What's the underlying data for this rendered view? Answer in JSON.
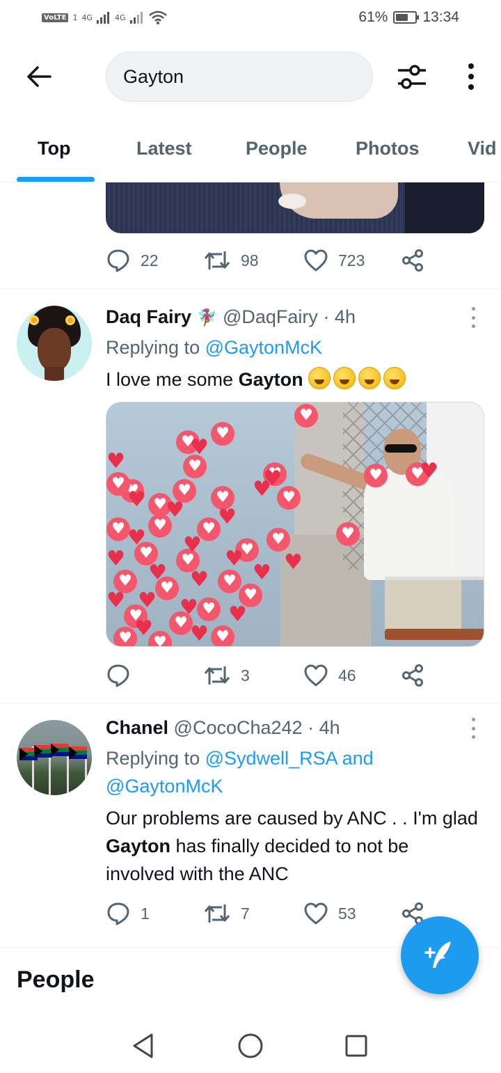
{
  "status_bar": {
    "network_left": "VoLTE",
    "sim_slot": "1",
    "signal1": "4G",
    "signal2": "4G",
    "battery": "61%",
    "time": "13:34"
  },
  "header": {
    "search_value": "Gayton"
  },
  "tabs": [
    {
      "label": "Top",
      "active": true
    },
    {
      "label": "Latest",
      "active": false
    },
    {
      "label": "People",
      "active": false
    },
    {
      "label": "Photos",
      "active": false
    },
    {
      "label": "Vid",
      "active": false
    }
  ],
  "prev_tweet": {
    "replies": "22",
    "retweets": "98",
    "likes": "723"
  },
  "tweets": [
    {
      "name": "Daq Fairy",
      "name_emoji": "🧚🏾‍♀️",
      "handle": "@DaqFairy",
      "time": "· 4h",
      "replying_prefix": "Replying to",
      "replying_to": "@GaytonMcK",
      "text_before": "I love me some ",
      "text_bold": "Gayton",
      "emoji_count": "4",
      "emoji_name": "rolling-on-floor-laughing",
      "replies": "",
      "retweets": "3",
      "likes": "46"
    },
    {
      "name": "Chanel",
      "handle": "@CocoCha242",
      "time": "· 4h",
      "replying_prefix": "Replying to",
      "replying_to": "@Sydwell_RSA and",
      "replying_to2": "@GaytonMcK",
      "text_before": "Our problems are caused by ANC . . I'm glad ",
      "text_bold": "Gayton",
      "text_after": " has finally decided to not be involved with the ANC",
      "replies": "1",
      "retweets": "7",
      "likes": "53"
    }
  ],
  "people_section": {
    "title": "People"
  },
  "colors": {
    "accent": "#1d9bf0",
    "text_primary": "#0f1419",
    "text_secondary": "#536471"
  },
  "icons": {
    "back": "arrow-left-icon",
    "filter": "filter-sliders-icon",
    "more": "more-vertical-icon",
    "reply": "reply-bubble-icon",
    "retweet": "retweet-icon",
    "like": "heart-icon",
    "share": "share-icon",
    "compose": "compose-feather-icon"
  }
}
